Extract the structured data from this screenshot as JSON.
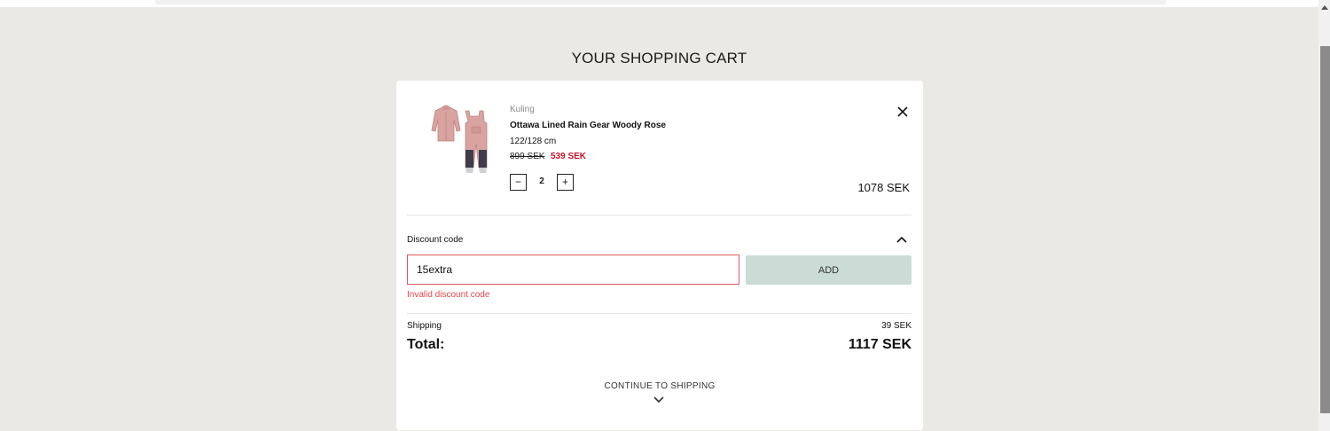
{
  "page": {
    "title": "YOUR SHOPPING CART"
  },
  "item": {
    "brand": "Kuling",
    "name": "Ottawa Lined Rain Gear Woody Rose",
    "size": "122/128 cm",
    "original_price": "899 SEK",
    "sale_price": "539 SEK",
    "quantity": "2",
    "quantity_minus": "−",
    "quantity_plus": "+",
    "line_total": "1078 SEK",
    "image_icon": "rain-gear-product-image",
    "remove_icon": "close-icon"
  },
  "discount": {
    "label": "Discount code",
    "toggle_icon": "chevron-up-icon",
    "input_value": "15extra",
    "add_label": "ADD",
    "error": "Invalid discount code"
  },
  "summary": {
    "shipping_label": "Shipping",
    "shipping_value": "39 SEK",
    "total_label": "Total:",
    "total_value": "1117 SEK"
  },
  "footer": {
    "continue_label": "CONTINUE TO SHIPPING",
    "continue_icon": "chevron-down-icon"
  },
  "colors": {
    "page_background": "#ebe9e5",
    "card_background": "#ffffff",
    "sale_price": "#c3132b",
    "error": "#e0474d",
    "input_error_border": "#e4595d",
    "add_button": "#cbdbd6",
    "product_pink": "#d9a3a0"
  }
}
